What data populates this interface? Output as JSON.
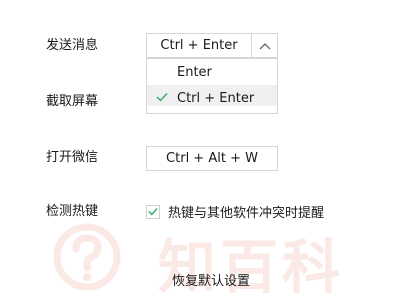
{
  "settings": {
    "send_message": {
      "label": "发送消息",
      "value": "Ctrl + Enter",
      "options": [
        {
          "label": "Enter",
          "selected": false
        },
        {
          "label": "Ctrl + Enter",
          "selected": true
        }
      ]
    },
    "screen_capture": {
      "label": "截取屏幕"
    },
    "open_wechat": {
      "label": "打开微信",
      "value": "Ctrl + Alt + W"
    },
    "detect_hotkey": {
      "label": "检测热键",
      "checkbox_label": "热键与其他软件冲突时提醒",
      "checked": true
    },
    "reset_label": "恢复默认设置"
  },
  "watermark": {
    "text": "知百科",
    "icon": "question-mark-icon",
    "color": "#e9a08a"
  },
  "colors": {
    "check": "#2aae67",
    "border": "#d6d6d6",
    "selected_bg": "#f0f0f0"
  }
}
